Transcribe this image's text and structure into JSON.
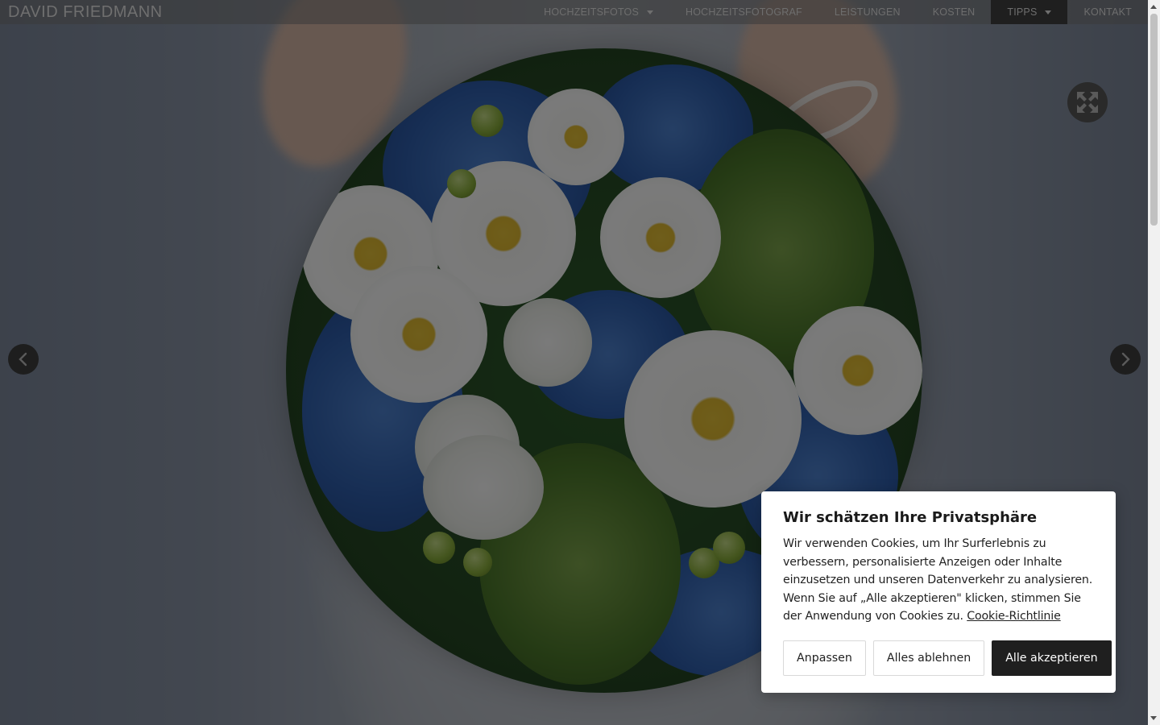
{
  "brand": {
    "name": "DAVID FRIEDMANN"
  },
  "nav": {
    "items": [
      {
        "label": "HOCHZEITSFOTOS",
        "has_dropdown": true,
        "active": false
      },
      {
        "label": "HOCHZEITSFOTOGRAF",
        "has_dropdown": false,
        "active": false
      },
      {
        "label": "LEISTUNGEN",
        "has_dropdown": false,
        "active": false
      },
      {
        "label": "KOSTEN",
        "has_dropdown": false,
        "active": false
      },
      {
        "label": "TIPPS",
        "has_dropdown": true,
        "active": true
      },
      {
        "label": "KONTAKT",
        "has_dropdown": false,
        "active": false
      }
    ]
  },
  "lightbox": {
    "fullscreen_icon": "expand-arrows-icon",
    "prev_icon": "chevron-left-icon",
    "next_icon": "chevron-right-icon"
  },
  "cookie": {
    "title": "Wir schätzen Ihre Privatsphäre",
    "text": "Wir verwenden Cookies, um Ihr Surferlebnis zu verbessern, personalisierte Anzeigen oder Inhalte einzusetzen und unseren Datenverkehr zu analysieren. Wenn Sie auf „Alle akzeptieren\" klicken, stimmen Sie der Anwendung von Cookies zu.",
    "link_label": "Cookie-Richtlinie",
    "buttons": {
      "customize": "Anpassen",
      "reject": "Alles ablehnen",
      "accept": "Alle akzeptieren"
    }
  },
  "colors": {
    "overlay": "#000000",
    "primary_button": "#1f1f1f",
    "active_nav": "#1f1f1f"
  }
}
